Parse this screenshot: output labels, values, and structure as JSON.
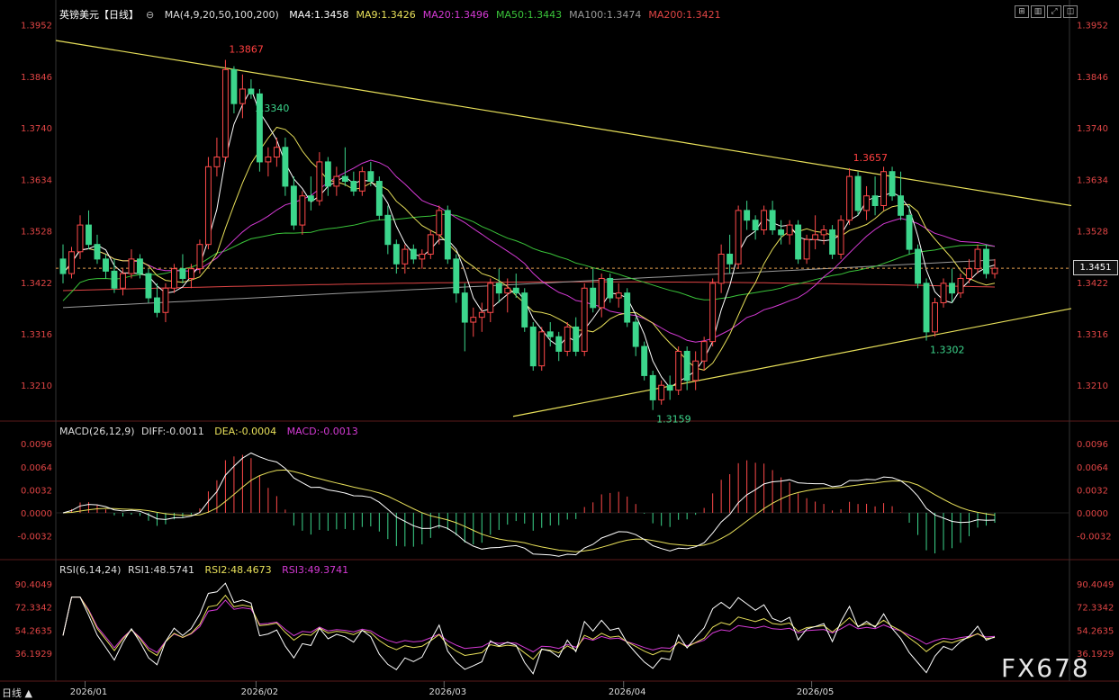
{
  "header": {
    "symbol": "英镑美元【日线】",
    "ma_params": "MA(4,9,20,50,100,200)",
    "ma_values": [
      {
        "label": "MA4:1.3458",
        "color": "#ffffff"
      },
      {
        "label": "MA9:1.3426",
        "color": "#e8e05a"
      },
      {
        "label": "MA20:1.3496",
        "color": "#d53ad5"
      },
      {
        "label": "MA50:1.3443",
        "color": "#3ac43a"
      },
      {
        "label": "MA100:1.3474",
        "color": "#9a9a9a"
      },
      {
        "label": "MA200:1.3421",
        "color": "#e04545"
      }
    ]
  },
  "macd_header": {
    "params": "MACD(26,12,9)",
    "diff": "DIFF:-0.0011",
    "dea": "DEA:-0.0004",
    "macd": "MACD:-0.0013"
  },
  "rsi_header": {
    "params": "RSI(6,14,24)",
    "rsi1": "RSI1:48.5741",
    "rsi2": "RSI2:48.4673",
    "rsi3": "RSI3:49.3741"
  },
  "current_price": "1.3451",
  "watermark": "FX678",
  "bottom_label": "日线 ▲",
  "chart_data": {
    "type": "candlestick",
    "price_axis": {
      "range": [
        1.314,
        1.397
      ],
      "ticks": [
        "1.3952",
        "1.3846",
        "1.3740",
        "1.3634",
        "1.3528",
        "1.3422",
        "1.3316",
        "1.3210"
      ]
    },
    "macd_axis": {
      "range": [
        -0.006,
        0.011
      ],
      "ticks": [
        "0.0096",
        "0.0064",
        "0.0032",
        "0.0000",
        "-0.0032"
      ]
    },
    "rsi_axis": {
      "range": [
        18,
        98
      ],
      "ticks": [
        "90.4049",
        "72.3342",
        "54.2635",
        "36.1929"
      ]
    },
    "x_labels": [
      "2026/01",
      "2026/02",
      "2026/03",
      "2026/04",
      "2026/05"
    ],
    "annotations": [
      {
        "text": "1.3867",
        "color": "#ff4040"
      },
      {
        "text": "1.3340",
        "color": "#3cd68c"
      },
      {
        "text": "1.3159",
        "color": "#3cd68c"
      },
      {
        "text": "1.3657",
        "color": "#ff4040"
      },
      {
        "text": "1.3302",
        "color": "#3cd68c"
      }
    ],
    "candles_ohlc": [
      [
        1.347,
        1.35,
        1.342,
        1.344
      ],
      [
        1.344,
        1.3495,
        1.343,
        1.3485
      ],
      [
        1.3485,
        1.356,
        1.347,
        1.354
      ],
      [
        1.354,
        1.357,
        1.349,
        1.35
      ],
      [
        1.35,
        1.352,
        1.346,
        1.347
      ],
      [
        1.347,
        1.348,
        1.343,
        1.3445
      ],
      [
        1.3445,
        1.347,
        1.34,
        1.341
      ],
      [
        1.341,
        1.345,
        1.3395,
        1.344
      ],
      [
        1.344,
        1.349,
        1.343,
        1.347
      ],
      [
        1.347,
        1.348,
        1.343,
        1.344
      ],
      [
        1.344,
        1.345,
        1.338,
        1.339
      ],
      [
        1.339,
        1.342,
        1.335,
        1.336
      ],
      [
        1.336,
        1.342,
        1.334,
        1.341
      ],
      [
        1.341,
        1.346,
        1.34,
        1.345
      ],
      [
        1.345,
        1.348,
        1.342,
        1.343
      ],
      [
        1.343,
        1.346,
        1.341,
        1.345
      ],
      [
        1.345,
        1.351,
        1.344,
        1.35
      ],
      [
        1.35,
        1.368,
        1.349,
        1.366
      ],
      [
        1.366,
        1.372,
        1.364,
        1.368
      ],
      [
        1.368,
        1.388,
        1.367,
        1.386
      ],
      [
        1.386,
        1.3867,
        1.377,
        1.379
      ],
      [
        1.379,
        1.385,
        1.376,
        1.382
      ],
      [
        1.382,
        1.384,
        1.38,
        1.381
      ],
      [
        1.381,
        1.382,
        1.365,
        1.367
      ],
      [
        1.367,
        1.37,
        1.364,
        1.368
      ],
      [
        1.368,
        1.372,
        1.366,
        1.37
      ],
      [
        1.37,
        1.372,
        1.36,
        1.362
      ],
      [
        1.362,
        1.364,
        1.353,
        1.354
      ],
      [
        1.354,
        1.361,
        1.352,
        1.36
      ],
      [
        1.36,
        1.364,
        1.357,
        1.359
      ],
      [
        1.359,
        1.369,
        1.358,
        1.367
      ],
      [
        1.367,
        1.368,
        1.36,
        1.362
      ],
      [
        1.362,
        1.366,
        1.36,
        1.364
      ],
      [
        1.364,
        1.37,
        1.362,
        1.363
      ],
      [
        1.363,
        1.365,
        1.36,
        1.361
      ],
      [
        1.361,
        1.366,
        1.36,
        1.365
      ],
      [
        1.365,
        1.367,
        1.362,
        1.363
      ],
      [
        1.363,
        1.364,
        1.355,
        1.356
      ],
      [
        1.356,
        1.358,
        1.348,
        1.35
      ],
      [
        1.35,
        1.351,
        1.344,
        1.346
      ],
      [
        1.346,
        1.35,
        1.344,
        1.349
      ],
      [
        1.349,
        1.35,
        1.346,
        1.347
      ],
      [
        1.347,
        1.349,
        1.345,
        1.348
      ],
      [
        1.348,
        1.353,
        1.347,
        1.352
      ],
      [
        1.352,
        1.358,
        1.35,
        1.357
      ],
      [
        1.357,
        1.358,
        1.346,
        1.347
      ],
      [
        1.347,
        1.348,
        1.338,
        1.34
      ],
      [
        1.34,
        1.342,
        1.328,
        1.334
      ],
      [
        1.334,
        1.337,
        1.331,
        1.335
      ],
      [
        1.335,
        1.338,
        1.332,
        1.336
      ],
      [
        1.336,
        1.343,
        1.334,
        1.342
      ],
      [
        1.342,
        1.345,
        1.338,
        1.34
      ],
      [
        1.34,
        1.343,
        1.336,
        1.341
      ],
      [
        1.341,
        1.344,
        1.339,
        1.34
      ],
      [
        1.34,
        1.341,
        1.332,
        1.333
      ],
      [
        1.333,
        1.334,
        1.324,
        1.325
      ],
      [
        1.325,
        1.333,
        1.324,
        1.332
      ],
      [
        1.332,
        1.334,
        1.329,
        1.331
      ],
      [
        1.331,
        1.332,
        1.326,
        1.328
      ],
      [
        1.328,
        1.334,
        1.327,
        1.333
      ],
      [
        1.333,
        1.335,
        1.327,
        1.328
      ],
      [
        1.328,
        1.342,
        1.327,
        1.341
      ],
      [
        1.341,
        1.345,
        1.336,
        1.337
      ],
      [
        1.337,
        1.344,
        1.335,
        1.343
      ],
      [
        1.343,
        1.344,
        1.338,
        1.339
      ],
      [
        1.339,
        1.342,
        1.337,
        1.34
      ],
      [
        1.34,
        1.341,
        1.333,
        1.334
      ],
      [
        1.334,
        1.335,
        1.327,
        1.329
      ],
      [
        1.329,
        1.33,
        1.322,
        1.323
      ],
      [
        1.323,
        1.324,
        1.3159,
        1.318
      ],
      [
        1.318,
        1.322,
        1.317,
        1.321
      ],
      [
        1.321,
        1.323,
        1.318,
        1.32
      ],
      [
        1.32,
        1.329,
        1.319,
        1.328
      ],
      [
        1.328,
        1.329,
        1.32,
        1.322
      ],
      [
        1.322,
        1.328,
        1.32,
        1.326
      ],
      [
        1.326,
        1.331,
        1.324,
        1.33
      ],
      [
        1.33,
        1.343,
        1.329,
        1.342
      ],
      [
        1.342,
        1.35,
        1.34,
        1.348
      ],
      [
        1.348,
        1.352,
        1.344,
        1.346
      ],
      [
        1.346,
        1.358,
        1.345,
        1.357
      ],
      [
        1.357,
        1.359,
        1.353,
        1.355
      ],
      [
        1.355,
        1.356,
        1.351,
        1.353
      ],
      [
        1.353,
        1.358,
        1.352,
        1.357
      ],
      [
        1.357,
        1.359,
        1.352,
        1.353
      ],
      [
        1.353,
        1.355,
        1.35,
        1.352
      ],
      [
        1.352,
        1.355,
        1.35,
        1.354
      ],
      [
        1.354,
        1.355,
        1.346,
        1.347
      ],
      [
        1.347,
        1.352,
        1.346,
        1.351
      ],
      [
        1.351,
        1.356,
        1.349,
        1.352
      ],
      [
        1.352,
        1.354,
        1.35,
        1.353
      ],
      [
        1.353,
        1.354,
        1.347,
        1.348
      ],
      [
        1.348,
        1.356,
        1.347,
        1.355
      ],
      [
        1.355,
        1.3657,
        1.354,
        1.364
      ],
      [
        1.364,
        1.365,
        1.356,
        1.357
      ],
      [
        1.357,
        1.362,
        1.355,
        1.36
      ],
      [
        1.36,
        1.364,
        1.356,
        1.358
      ],
      [
        1.358,
        1.366,
        1.357,
        1.365
      ],
      [
        1.365,
        1.366,
        1.359,
        1.36
      ],
      [
        1.36,
        1.365,
        1.355,
        1.356
      ],
      [
        1.356,
        1.358,
        1.348,
        1.349
      ],
      [
        1.349,
        1.35,
        1.341,
        1.342
      ],
      [
        1.342,
        1.343,
        1.3302,
        1.332
      ],
      [
        1.332,
        1.339,
        1.331,
        1.338
      ],
      [
        1.338,
        1.343,
        1.337,
        1.342
      ],
      [
        1.342,
        1.345,
        1.338,
        1.34
      ],
      [
        1.34,
        1.344,
        1.339,
        1.343
      ],
      [
        1.343,
        1.347,
        1.342,
        1.345
      ],
      [
        1.345,
        1.35,
        1.344,
        1.349
      ],
      [
        1.349,
        1.35,
        1.343,
        1.344
      ],
      [
        1.344,
        1.347,
        1.343,
        1.3451
      ]
    ]
  }
}
